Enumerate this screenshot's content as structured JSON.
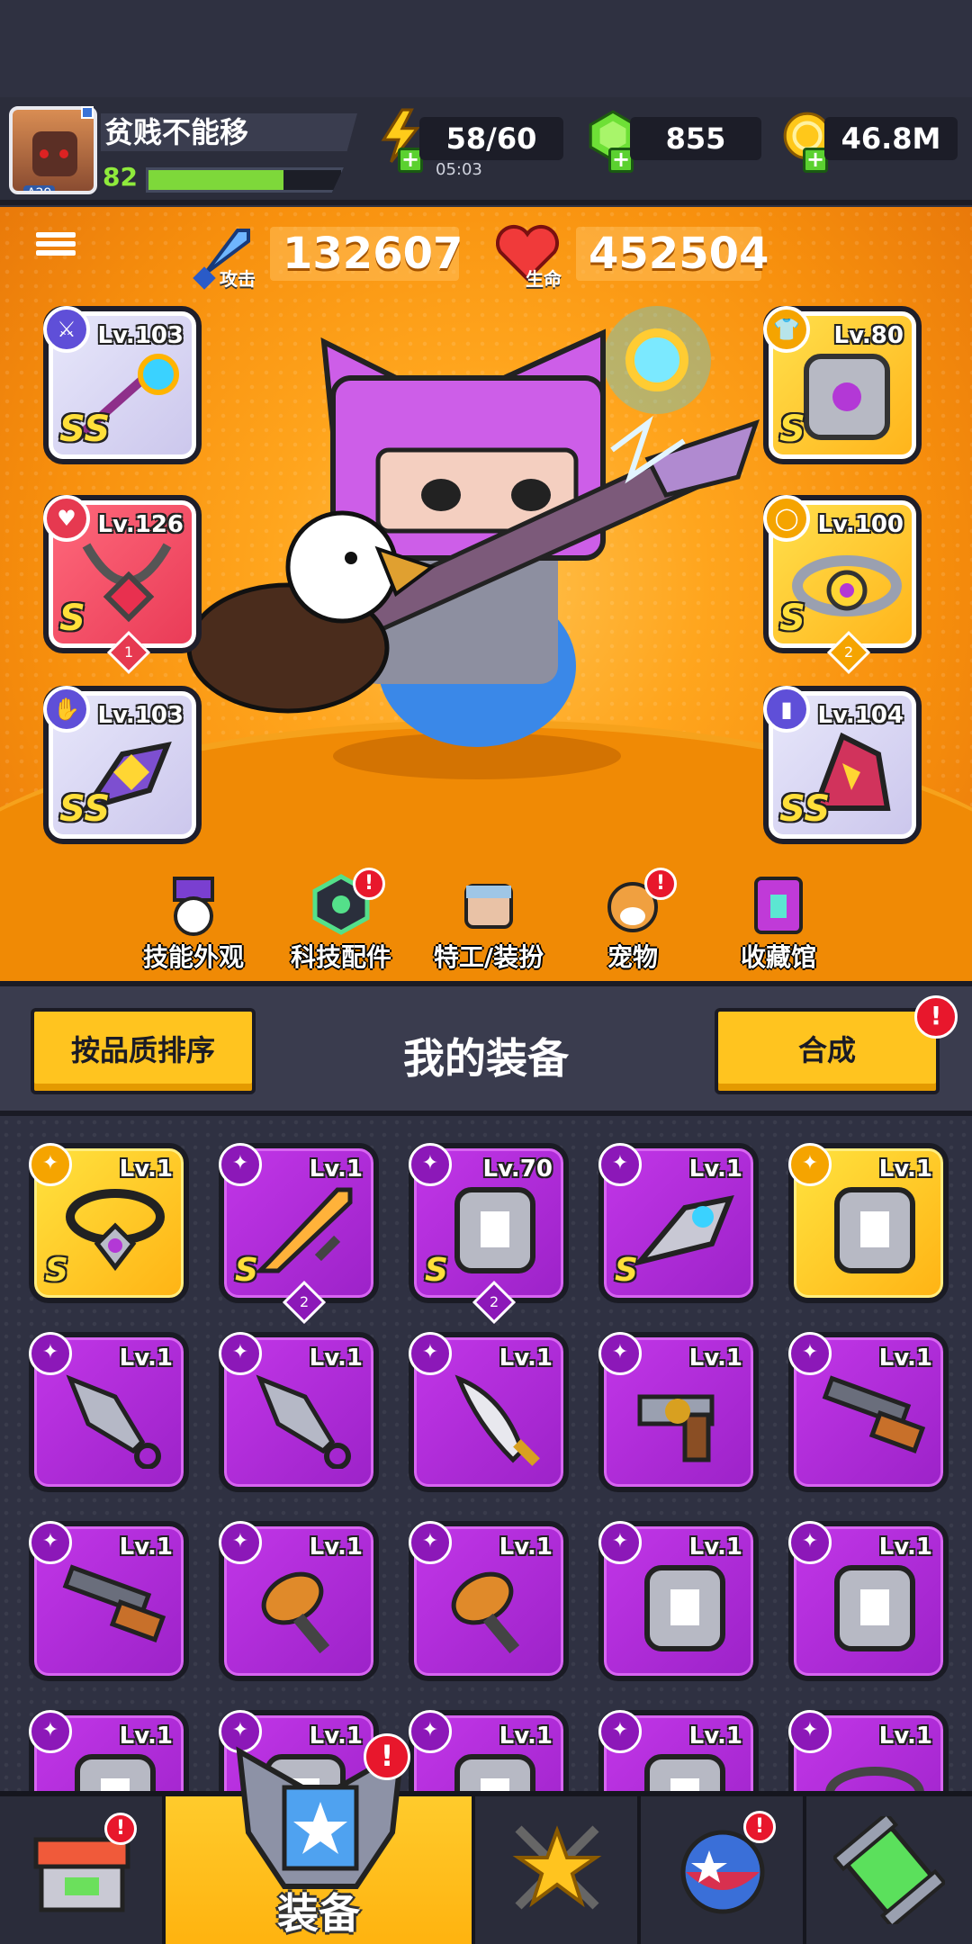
{
  "player": {
    "name": "贫贱不能移",
    "level": "82",
    "avatar_tag": "A29",
    "xp_progress": 0.7
  },
  "resources": {
    "energy": "58/60",
    "energy_timer": "05:03",
    "gems": "855",
    "coins": "46.8M"
  },
  "stats": {
    "attack_value": "132607",
    "attack_label": "攻击",
    "hp_value": "452504",
    "hp_label": "生命"
  },
  "equipped": [
    {
      "slot": "weapon",
      "level": "Lv.103",
      "grade": "SS",
      "color": "purple",
      "icon": "sword-icon"
    },
    {
      "slot": "necklace",
      "level": "Lv.126",
      "grade": "S",
      "color": "red",
      "stars": "1",
      "icon": "necklace-icon"
    },
    {
      "slot": "gloves",
      "level": "Lv.103",
      "grade": "SS",
      "color": "purple",
      "icon": "glove-icon"
    },
    {
      "slot": "armor",
      "level": "Lv.80",
      "grade": "S",
      "color": "gold",
      "icon": "armor-icon"
    },
    {
      "slot": "belt",
      "level": "Lv.100",
      "grade": "S",
      "color": "gold",
      "stars": "2",
      "icon": "belt-icon"
    },
    {
      "slot": "boots",
      "level": "Lv.104",
      "grade": "SS",
      "color": "purple",
      "icon": "boots-icon"
    }
  ],
  "features": [
    {
      "label": "技能外观",
      "alert": false
    },
    {
      "label": "科技配件",
      "alert": true
    },
    {
      "label": "特工/装扮",
      "alert": false
    },
    {
      "label": "宠物",
      "alert": true
    },
    {
      "label": "收藏馆",
      "alert": false
    }
  ],
  "panel": {
    "sort_label": "按品质排序",
    "title": "我的装备",
    "merge_label": "合成",
    "merge_alert": "!"
  },
  "inventory": [
    {
      "level": "Lv.1",
      "grade": "S",
      "gold": true
    },
    {
      "level": "Lv.1",
      "grade": "S",
      "stars": "2"
    },
    {
      "level": "Lv.70",
      "grade": "S",
      "stars": "2"
    },
    {
      "level": "Lv.1",
      "grade": "S"
    },
    {
      "level": "Lv.1",
      "grade": "",
      "gold": true
    },
    {
      "level": "Lv.1"
    },
    {
      "level": "Lv.1"
    },
    {
      "level": "Lv.1"
    },
    {
      "level": "Lv.1"
    },
    {
      "level": "Lv.1"
    },
    {
      "level": "Lv.1"
    },
    {
      "level": "Lv.1"
    },
    {
      "level": "Lv.1"
    },
    {
      "level": "Lv.1"
    },
    {
      "level": "Lv.1"
    },
    {
      "level": "Lv.1"
    },
    {
      "level": "Lv.1"
    },
    {
      "level": "Lv.1"
    },
    {
      "level": "Lv.1"
    },
    {
      "level": "Lv.1"
    }
  ],
  "nav": {
    "active_label": "装备",
    "alert": "!"
  },
  "colors": {
    "accent": "#ffc41f",
    "epic": "#b02bd9",
    "legendary": "#ffb314",
    "alert": "#e8172c"
  }
}
